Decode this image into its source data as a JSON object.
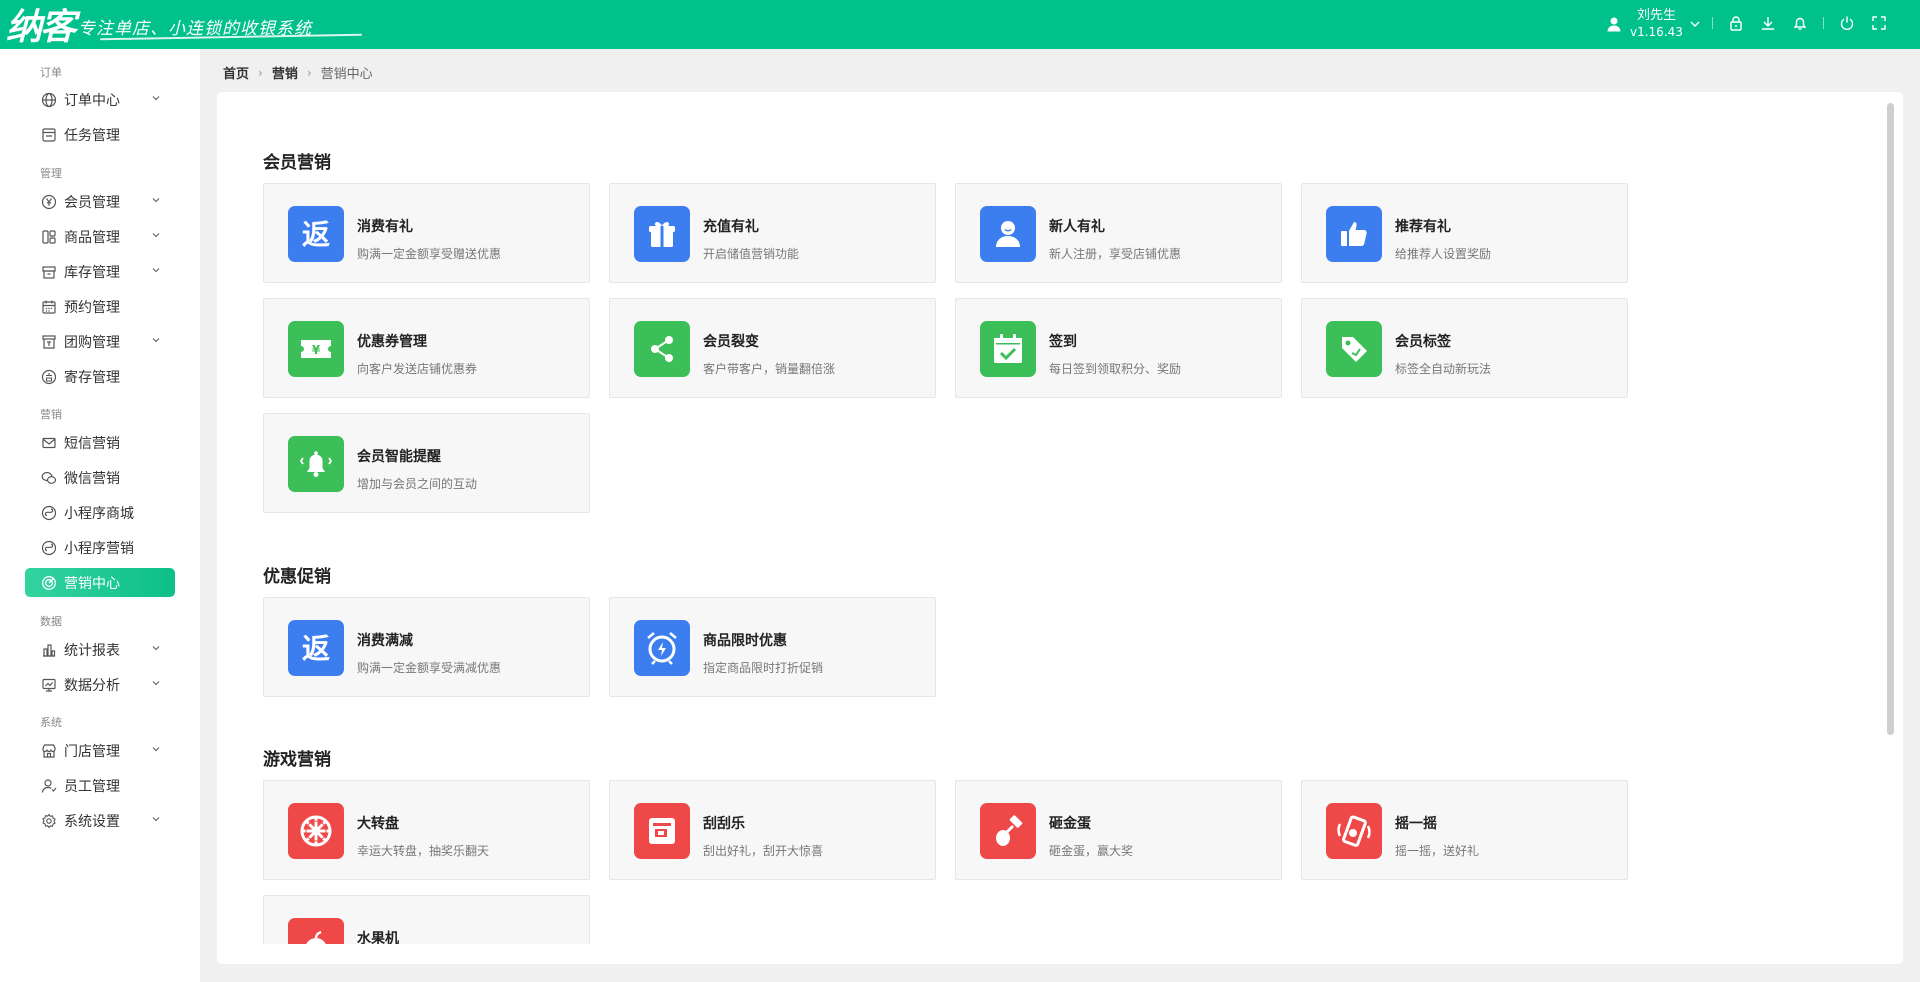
{
  "header": {
    "logo_main": "纳客",
    "logo_slogan": "专注单店、小连锁的收银系统",
    "user_name": "刘先生",
    "version": "v1.16.43",
    "accent_color": "#00c08b",
    "icons": [
      "lock-icon",
      "download-icon",
      "bell-icon",
      "power-icon",
      "fullscreen-icon"
    ]
  },
  "sidebar": {
    "groups": {
      "order": "订单",
      "manage": "管理",
      "marketing": "营销",
      "data": "数据",
      "system": "系统"
    },
    "items": [
      {
        "label": "订单中心",
        "icon": "globe-icon"
      },
      {
        "label": "任务管理",
        "icon": "task-icon"
      },
      {
        "label": "会员管理",
        "icon": "yuan-icon"
      },
      {
        "label": "商品管理",
        "icon": "goods-icon"
      },
      {
        "label": "库存管理",
        "icon": "inventory-icon"
      },
      {
        "label": "预约管理",
        "icon": "calendar-icon"
      },
      {
        "label": "团购管理",
        "icon": "group-buy-icon"
      },
      {
        "label": "寄存管理",
        "icon": "deposit-icon"
      },
      {
        "label": "短信营销",
        "icon": "mail-icon"
      },
      {
        "label": "微信营销",
        "icon": "wechat-icon"
      },
      {
        "label": "小程序商城",
        "icon": "miniprogram-icon"
      },
      {
        "label": "小程序营销",
        "icon": "miniprogram-icon"
      },
      {
        "label": "营销中心",
        "icon": "target-icon"
      },
      {
        "label": "统计报表",
        "icon": "bar-chart-icon"
      },
      {
        "label": "数据分析",
        "icon": "monitor-chart-icon"
      },
      {
        "label": "门店管理",
        "icon": "store-icon"
      },
      {
        "label": "员工管理",
        "icon": "user-icon"
      },
      {
        "label": "系统设置",
        "icon": "settings-icon"
      }
    ]
  },
  "breadcrumb": [
    "首页",
    "营销",
    "营销中心"
  ],
  "sections": [
    {
      "title": "会员营销",
      "cards": [
        {
          "title": "消费有礼",
          "desc": "购满一定金额享受赠送优惠",
          "icon": "rebate-icon",
          "color": "blue"
        },
        {
          "title": "充值有礼",
          "desc": "开启储值营销功能",
          "icon": "gift-icon",
          "color": "blue"
        },
        {
          "title": "新人有礼",
          "desc": "新人注册，享受店铺优惠",
          "icon": "person-icon",
          "color": "blue"
        },
        {
          "title": "推荐有礼",
          "desc": "给推荐人设置奖励",
          "icon": "thumbs-up-icon",
          "color": "blue"
        },
        {
          "title": "优惠券管理",
          "desc": "向客户发送店铺优惠券",
          "icon": "coupon-icon",
          "color": "green"
        },
        {
          "title": "会员裂变",
          "desc": "客户带客户，销量翻倍涨",
          "icon": "share-icon",
          "color": "green"
        },
        {
          "title": "签到",
          "desc": "每日签到领取积分、奖励",
          "icon": "checkin-calendar-icon",
          "color": "green"
        },
        {
          "title": "会员标签",
          "desc": "标签全自动新玩法",
          "icon": "tag-icon",
          "color": "green"
        },
        {
          "title": "会员智能提醒",
          "desc": "增加与会员之间的互动",
          "icon": "bell-icon",
          "color": "green"
        }
      ]
    },
    {
      "title": "优惠促销",
      "cards": [
        {
          "title": "消费满减",
          "desc": "购满一定金额享受满减优惠",
          "icon": "rebate-icon",
          "color": "blue"
        },
        {
          "title": "商品限时优惠",
          "desc": "指定商品限时打折促销",
          "icon": "alarm-clock-icon",
          "color": "blue"
        }
      ]
    },
    {
      "title": "游戏营销",
      "cards": [
        {
          "title": "大转盘",
          "desc": "幸运大转盘，抽奖乐翻天",
          "icon": "wheel-icon",
          "color": "red"
        },
        {
          "title": "刮刮乐",
          "desc": "刮出好礼，刮开大惊喜",
          "icon": "scratch-card-icon",
          "color": "red"
        },
        {
          "title": "砸金蛋",
          "desc": "砸金蛋，赢大奖",
          "icon": "hammer-egg-icon",
          "color": "red"
        },
        {
          "title": "摇一摇",
          "desc": "摇一摇，送好礼",
          "icon": "shake-phone-icon",
          "color": "red"
        },
        {
          "title": "水果机",
          "desc": "",
          "icon": "fruit-icon",
          "color": "red"
        }
      ]
    }
  ]
}
